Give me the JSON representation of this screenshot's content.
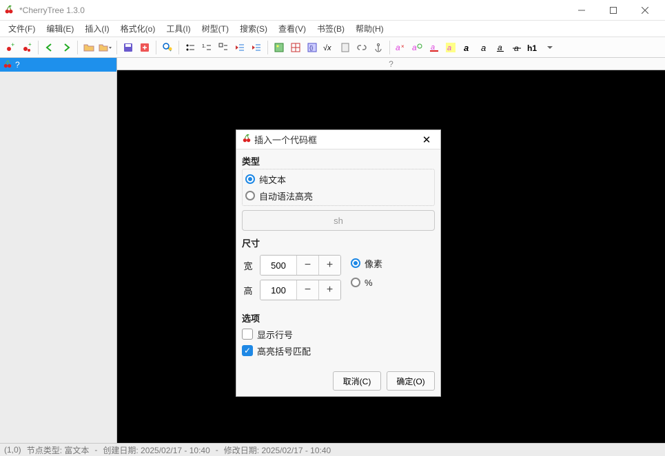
{
  "window": {
    "title": "*CherryTree 1.3.0"
  },
  "menu": [
    "文件(F)",
    "编辑(E)",
    "插入(I)",
    "格式化(o)",
    "工具(I)",
    "树型(T)",
    "搜索(S)",
    "查看(V)",
    "书签(B)",
    "帮助(H)"
  ],
  "tree": {
    "node_label": "?"
  },
  "ruler": {
    "marker": "?"
  },
  "status": {
    "cursor": "(1,0)",
    "node_type": "节点类型: 富文本",
    "sep": "-",
    "created": "创建日期: 2025/02/17 - 10:40",
    "modified": "修改日期: 2025/02/17 - 10:40"
  },
  "dialog": {
    "title": "插入一个代码框",
    "section_type": "类型",
    "radio_plain": "纯文本",
    "radio_auto": "自动语法高亮",
    "lang_value": "sh",
    "section_size": "尺寸",
    "width_label": "宽",
    "width_value": "500",
    "height_label": "高",
    "height_value": "100",
    "unit_pixels": "像素",
    "unit_percent": "%",
    "section_options": "选项",
    "opt_linenum": "显示行号",
    "opt_bracket": "高亮括号匹配",
    "btn_cancel": "取消(C)",
    "btn_ok": "确定(O)"
  }
}
